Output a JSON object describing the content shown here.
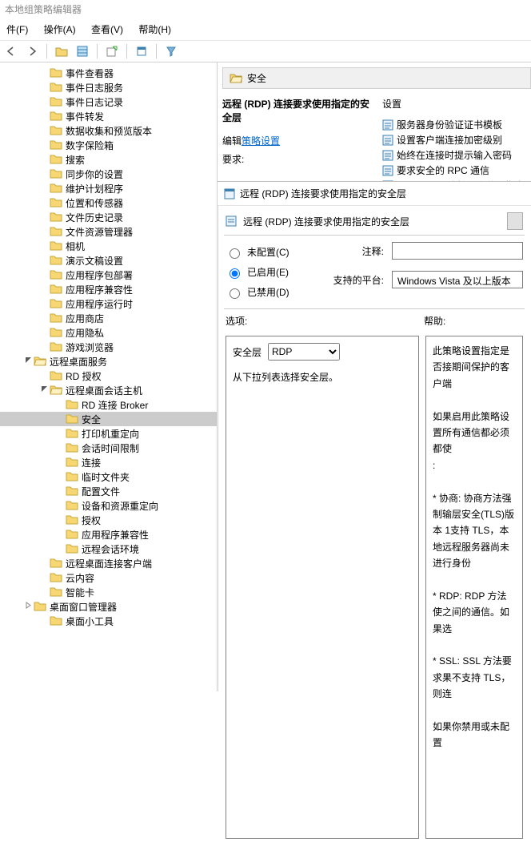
{
  "window_title": "本地组策略编辑器",
  "menu": {
    "file": "件(F)",
    "action": "操作(A)",
    "view": "查看(V)",
    "help": "帮助(H)"
  },
  "tree": {
    "items": [
      {
        "d": 2,
        "t": "n",
        "l": "事件查看器"
      },
      {
        "d": 2,
        "t": "n",
        "l": "事件日志服务"
      },
      {
        "d": 2,
        "t": "n",
        "l": "事件日志记录"
      },
      {
        "d": 2,
        "t": "n",
        "l": "事件转发"
      },
      {
        "d": 2,
        "t": "n",
        "l": "数据收集和预览版本"
      },
      {
        "d": 2,
        "t": "n",
        "l": "数字保险箱"
      },
      {
        "d": 2,
        "t": "n",
        "l": "搜索"
      },
      {
        "d": 2,
        "t": "n",
        "l": "同步你的设置"
      },
      {
        "d": 2,
        "t": "n",
        "l": "维护计划程序"
      },
      {
        "d": 2,
        "t": "n",
        "l": "位置和传感器"
      },
      {
        "d": 2,
        "t": "n",
        "l": "文件历史记录"
      },
      {
        "d": 2,
        "t": "n",
        "l": "文件资源管理器"
      },
      {
        "d": 2,
        "t": "n",
        "l": "相机"
      },
      {
        "d": 2,
        "t": "n",
        "l": "演示文稿设置"
      },
      {
        "d": 2,
        "t": "n",
        "l": "应用程序包部署"
      },
      {
        "d": 2,
        "t": "n",
        "l": "应用程序兼容性"
      },
      {
        "d": 2,
        "t": "n",
        "l": "应用程序运行时"
      },
      {
        "d": 2,
        "t": "n",
        "l": "应用商店"
      },
      {
        "d": 2,
        "t": "n",
        "l": "应用隐私"
      },
      {
        "d": 2,
        "t": "n",
        "l": "游戏浏览器"
      },
      {
        "d": 1,
        "t": "o",
        "l": "远程桌面服务"
      },
      {
        "d": 2,
        "t": "n",
        "l": "RD 授权"
      },
      {
        "d": 2,
        "t": "o",
        "l": "远程桌面会话主机"
      },
      {
        "d": 3,
        "t": "n",
        "l": "RD 连接 Broker"
      },
      {
        "d": 3,
        "t": "n",
        "l": "安全",
        "sel": true
      },
      {
        "d": 3,
        "t": "n",
        "l": "打印机重定向"
      },
      {
        "d": 3,
        "t": "n",
        "l": "会话时间限制"
      },
      {
        "d": 3,
        "t": "n",
        "l": "连接"
      },
      {
        "d": 3,
        "t": "n",
        "l": "临时文件夹"
      },
      {
        "d": 3,
        "t": "n",
        "l": "配置文件"
      },
      {
        "d": 3,
        "t": "n",
        "l": "设备和资源重定向"
      },
      {
        "d": 3,
        "t": "n",
        "l": "授权"
      },
      {
        "d": 3,
        "t": "n",
        "l": "应用程序兼容性"
      },
      {
        "d": 3,
        "t": "n",
        "l": "远程会话环境"
      },
      {
        "d": 2,
        "t": "n",
        "l": "远程桌面连接客户端"
      },
      {
        "d": 2,
        "t": "n",
        "l": "云内容"
      },
      {
        "d": 2,
        "t": "n",
        "l": "智能卡"
      },
      {
        "d": 1,
        "t": "c",
        "l": "桌面窗口管理器"
      },
      {
        "d": 2,
        "t": "n",
        "l": "桌面小工具"
      }
    ]
  },
  "crumb": "安全",
  "info": {
    "title": "远程 (RDP) 连接要求使用指定的安全层",
    "edit_label": "编辑",
    "edit_link": "策略设置",
    "req_label": "要求:",
    "col_label": "设置",
    "settings": [
      "服务器身份验证证书模板",
      "设置客户端连接加密级别",
      "始终在连接时提示输入密码",
      "要求安全的 RPC 通信",
      "远程 (RDP) 连接要求使用指定"
    ]
  },
  "dialog": {
    "win_title": "远程 (RDP) 连接要求使用指定的安全层",
    "header": "远程 (RDP) 连接要求使用指定的安全层",
    "radio_unconfigured": "未配置(C)",
    "radio_enabled": "已启用(E)",
    "radio_disabled": "已禁用(D)",
    "comment_label": "注释:",
    "platform_label": "支持的平台:",
    "platform_value": "Windows Vista 及以上版本",
    "options_label": "选项:",
    "help_label": "帮助:",
    "opt_layer_label": "安全层",
    "opt_layer_value": "RDP",
    "opt_instruction": "从下拉列表选择安全层。",
    "help_text": [
      "此策略设置指定是否接期间保护的客户端",
      "",
      "如果启用此策略设置所有通信都必须都使",
      ":",
      "",
      "* 协商: 协商方法强制输层安全(TLS)版本 1支持 TLS，本地远程服务器尚未进行身份",
      "",
      "* RDP: RDP 方法使之间的通信。如果选",
      "",
      "* SSL: SSL 方法要求果不支持 TLS，则连",
      "",
      "如果你禁用或未配置"
    ]
  }
}
